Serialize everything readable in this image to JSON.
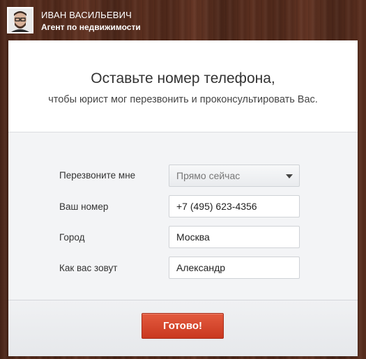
{
  "header": {
    "agent_name": "ИВАН ВАСИЛЬЕВИЧ",
    "agent_role": "Агент по недвижимости"
  },
  "card": {
    "title": "Оставьте номер телефона,",
    "subtitle": "чтобы юрист мог перезвонить и проконсультировать Вас."
  },
  "form": {
    "callback_label": "Перезвоните мне",
    "callback_selected": "Прямо сейчас",
    "phone_label": "Ваш номер",
    "phone_value": "+7 (495) 623-4356",
    "city_label": "Город",
    "city_value": "Москва",
    "name_label": "Как вас зовут",
    "name_value": "Александр"
  },
  "actions": {
    "submit_label": "Готово!"
  },
  "colors": {
    "submit_button": "#d2452b",
    "wood_background": "#4f2a1c"
  }
}
